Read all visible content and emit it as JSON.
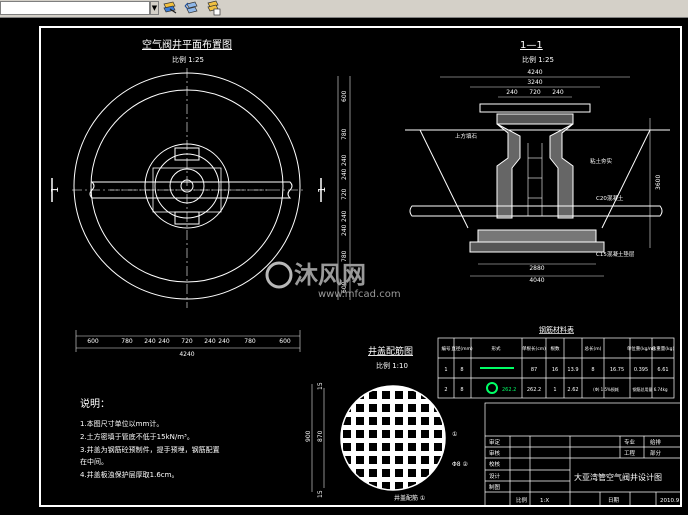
{
  "colors": {
    "background": "#000000",
    "line": "#ffffff",
    "dim": "#e8e8e8",
    "accent_green": "#00ff66",
    "watermark": "#9a9a9a",
    "watermark_logo": "#b8b8b8",
    "chrome": "#d4d0c8"
  },
  "toolbar": {
    "icons": [
      "layer-match-icon",
      "layer-previous-icon",
      "layer-states-icon"
    ]
  },
  "plan": {
    "title": "空气阀井平面布置图",
    "scale": "比例 1:25",
    "left_marker": "1",
    "right_marker": "1",
    "dims_bottom": [
      "600",
      "780",
      "240",
      "240",
      "720",
      "240",
      "240",
      "780",
      "600"
    ],
    "dim_total": "4240",
    "dims_right": [
      "600",
      "780",
      "240",
      "240",
      "720",
      "240",
      "240",
      "780",
      "600"
    ]
  },
  "section": {
    "title": "1—1",
    "scale": "比例 1:25",
    "dims_top": [
      "4240",
      "3240",
      "240",
      "720",
      "240"
    ],
    "dims_bottom": [
      "2880",
      "4040"
    ],
    "depth": "3600",
    "notes": [
      "上方填石",
      "粘土夯实",
      "C20混凝土",
      "C15混凝土垫层"
    ]
  },
  "table": {
    "title": "钢筋材料表",
    "headers": [
      "编号",
      "直径(mm)",
      "形式",
      "单根长(cm)",
      "根数",
      "总长(m)",
      "单位重(kg/m)",
      "总重量(kg)"
    ],
    "rows": [
      [
        "1",
        "8",
        "",
        "87",
        "16",
        "13.9",
        "8",
        "16.75",
        "0.395",
        "6.61"
      ],
      [
        "2",
        "8",
        "",
        "262.2",
        "1",
        "2.62",
        "",
        "(Φ) 1.5%损耗",
        "钢筋总用量 6.74kg",
        ""
      ]
    ],
    "row2_length": "262.2"
  },
  "cover": {
    "title": "井盖配筋图",
    "scale": "比例 1:10",
    "dim_left": "900",
    "dim_inner": "870",
    "dim_top": "15",
    "dim_bottom": "15",
    "label1": "①",
    "label2": "Φ8 ②",
    "bottom_label": "井盖配筋 ①"
  },
  "notes": {
    "heading": "说明：",
    "lines": [
      "1.本图尺寸单位以mm计。",
      "2.土方密填于管底不低于15kN/m³。",
      "3.井盖为钢筋砼预制件，提手预埋，钢筋配置",
      "  在中间。",
      "4.井盖板浊保护层厚取1.6cm。"
    ]
  },
  "title_block": {
    "project_name": "大亚湾管空气阀井设计图",
    "rows": [
      [
        "审定",
        "",
        "",
        "专业",
        "给排"
      ],
      [
        "审核",
        "",
        "",
        "工程",
        "部分"
      ],
      [
        "校核",
        "",
        "",
        "",
        ""
      ],
      [
        "设计",
        "",
        "",
        "",
        ""
      ],
      [
        "制图",
        "",
        "",
        "",
        ""
      ]
    ],
    "footer": [
      "比例",
      "1:X",
      "日期",
      "2010.9"
    ]
  },
  "watermark": {
    "brand": "沐风网",
    "url": "www.mfcad.com"
  }
}
